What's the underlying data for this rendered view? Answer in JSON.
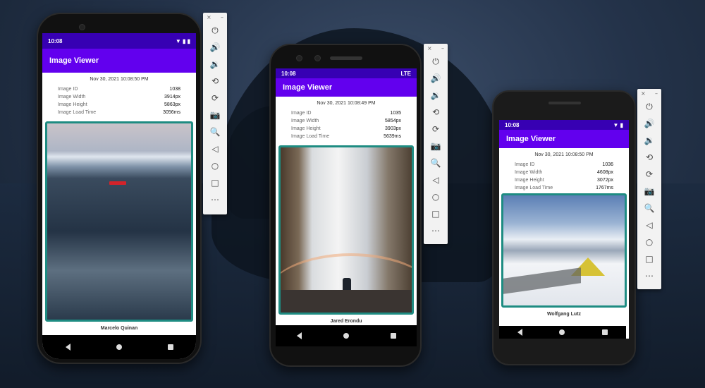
{
  "colors": {
    "appbar": "#6200ee",
    "statusbar": "#3700b3",
    "accent_border": "#1e8c82"
  },
  "phones": [
    {
      "time": "10:08",
      "title": "Image Viewer",
      "timestamp": "Nov 30, 2021 10:08:50 PM",
      "fields": [
        {
          "k": "Image ID",
          "v": "1038"
        },
        {
          "k": "Image Width",
          "v": "3914px"
        },
        {
          "k": "Image Height",
          "v": "5863px"
        },
        {
          "k": "Image Load Time",
          "v": "3056ms"
        }
      ],
      "author": "Marcelo Quinan"
    },
    {
      "time": "10:08",
      "network": "LTE",
      "title": "Image Viewer",
      "timestamp": "Nov 30, 2021 10:08:49 PM",
      "fields": [
        {
          "k": "Image ID",
          "v": "1035"
        },
        {
          "k": "Image Width",
          "v": "5854px"
        },
        {
          "k": "Image Height",
          "v": "3903px"
        },
        {
          "k": "Image Load Time",
          "v": "5639ms"
        }
      ],
      "author": "Jared Erondu"
    },
    {
      "time": "10:08",
      "title": "Image Viewer",
      "timestamp": "Nov 30, 2021 10:08:50 PM",
      "fields": [
        {
          "k": "Image ID",
          "v": "1036"
        },
        {
          "k": "Image Width",
          "v": "4608px"
        },
        {
          "k": "Image Height",
          "v": "3072px"
        },
        {
          "k": "Image Load Time",
          "v": "1767ms"
        }
      ],
      "author": "Wolfgang Lutz"
    }
  ],
  "emulator_toolbar": {
    "close": "×",
    "minimize": "–",
    "buttons": [
      {
        "icon": "power-icon",
        "glyph": "⏻"
      },
      {
        "icon": "volume-up-icon",
        "glyph": "🔊"
      },
      {
        "icon": "volume-down-icon",
        "glyph": "🔉"
      },
      {
        "icon": "rotate-left-icon",
        "glyph": "⟲"
      },
      {
        "icon": "rotate-right-icon",
        "glyph": "⟳"
      },
      {
        "icon": "camera-icon",
        "glyph": "📷"
      },
      {
        "icon": "zoom-icon",
        "glyph": "🔍"
      },
      {
        "icon": "back-icon",
        "glyph": "◁"
      },
      {
        "icon": "home-icon",
        "glyph": "○"
      },
      {
        "icon": "overview-icon",
        "glyph": "□"
      },
      {
        "icon": "more-icon",
        "glyph": "⋯"
      }
    ]
  }
}
